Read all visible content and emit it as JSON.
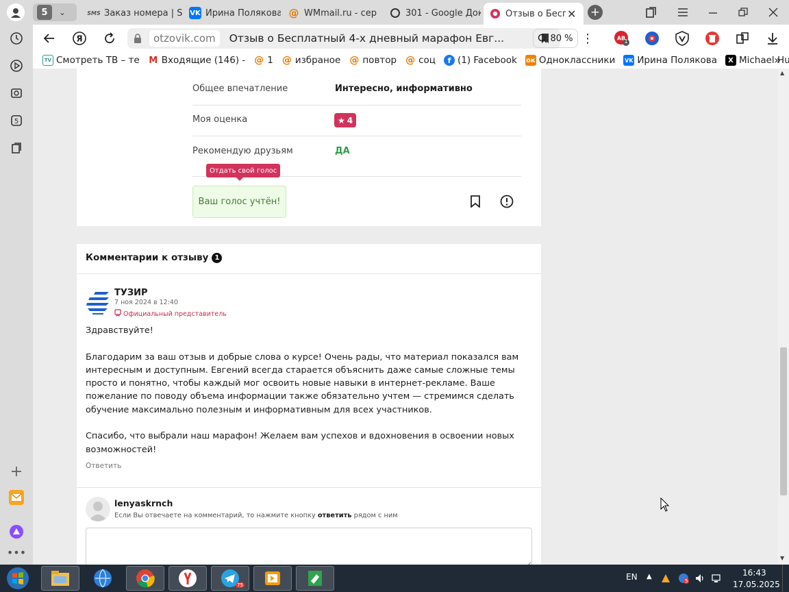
{
  "browser": {
    "tab_group_count": "5",
    "tabs": [
      {
        "label": "Заказ номера | S",
        "icon_text": "SMS",
        "active": false
      },
      {
        "label": "Ирина Полякова",
        "icon_text": "VK",
        "active": false
      },
      {
        "label": "WMmail.ru - сер",
        "icon_text": "@",
        "active": false
      },
      {
        "label": "301 - Google Док",
        "icon_text": "O",
        "active": false
      },
      {
        "label": "Отзыв о Беспл",
        "icon_text": "o",
        "active": true
      }
    ],
    "url_domain": "otzovik.com",
    "page_title": "Отзыв о Бесплатный 4-х дневный марафон Евг...",
    "zoom": "80 %",
    "ext_badge_1": "1",
    "bookmarks": [
      {
        "label": "Смотреть ТВ – те",
        "icon": "tv-icon"
      },
      {
        "label": "Входящие (146) -",
        "icon": "gmail-icon"
      },
      {
        "label": "1",
        "icon": "wmmail-icon"
      },
      {
        "label": "избраное",
        "icon": "wmmail-icon"
      },
      {
        "label": "повтор",
        "icon": "wmmail-icon"
      },
      {
        "label": "соц",
        "icon": "wmmail-icon"
      },
      {
        "label": "(1) Facebook",
        "icon": "facebook-icon"
      },
      {
        "label": "Одноклассники",
        "icon": "odnoklassniki-icon"
      },
      {
        "label": "Ирина Полякова",
        "icon": "vk-icon"
      },
      {
        "label": "Michael Hudso",
        "icon": "x-icon"
      }
    ]
  },
  "review": {
    "impression_label": "Общее впечатление",
    "impression_value": "Интересно, информативно",
    "rating_label": "Моя оценка",
    "rating_value": "4",
    "recommend_label": "Рекомендую друзьям",
    "recommend_value": "ДА",
    "vote_tooltip": "Отдать свой голос",
    "vote_status": "Ваш голос учтён!"
  },
  "comments": {
    "heading": "Комментарии к отзыву",
    "count": "1",
    "items": [
      {
        "author": "ТУЗИР",
        "date": "7 ноя 2024 в 12:40",
        "badge": "Официальный представитель",
        "paragraphs": [
          "Здравствуйте!",
          "Благодарим за ваш отзыв и добрые слова о курсе! Очень рады, что материал показался вам интересным и доступным. Евгений всегда старается объяснить даже самые сложные темы просто и понятно, чтобы каждый мог освоить новые навыки в интернет-рекламе. Ваше пожелание по поводу объема информации также обязательно учтем — стремимся сделать обучение максимально полезным и информативным для всех участников.",
          "Спасибо, что выбрали наш марафон! Желаем вам успехов и вдохновения в освоении новых возможностей!"
        ],
        "reply_label": "Ответить"
      }
    ],
    "new_comment": {
      "username": "lenyaskrnch",
      "hint_before": "Если Вы отвечаете на комментарий, то нажмите кнопку",
      "hint_bold": "ответить",
      "hint_after": "рядом с ним"
    }
  },
  "taskbar": {
    "language": "EN",
    "telegram_badge": "75",
    "yandex_tray_badge": "5",
    "time": "16:43",
    "date": "17.05.2025"
  },
  "colors": {
    "accent_pink": "#d2335c",
    "recommend_green": "#2e9e45",
    "vote_bg": "#eefbe6",
    "vote_border": "#cfe9c2",
    "official_red": "#c62b52"
  }
}
